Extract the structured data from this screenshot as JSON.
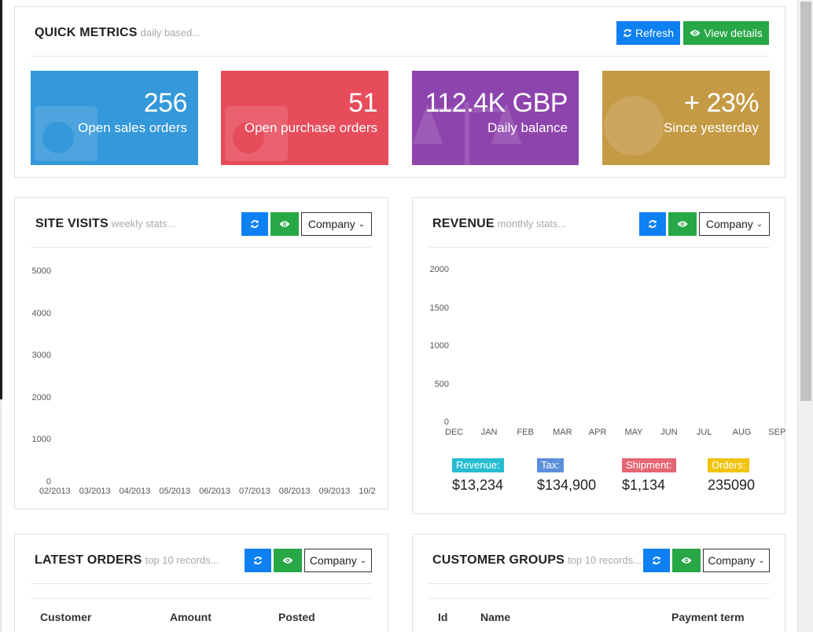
{
  "quick_metrics": {
    "title": "QUICK METRICS",
    "subtitle": "daily based...",
    "refresh_label": "Refresh",
    "view_details_label": "View details",
    "tiles": [
      {
        "value": "256",
        "caption": "Open sales orders",
        "color": "#3498db"
      },
      {
        "value": "51",
        "caption": "Open purchase orders",
        "color": "#e74c5b"
      },
      {
        "value": "112.4K GBP",
        "caption": "Daily balance",
        "color": "#8e44ad"
      },
      {
        "value": "+ 23%",
        "caption": "Since yesterday",
        "color": "#c59a45"
      }
    ]
  },
  "site_visits": {
    "title": "SITE VISITS",
    "subtitle": "weekly stats...",
    "dropdown_label": "Company"
  },
  "revenue": {
    "title": "REVENUE",
    "subtitle": "monthly stats...",
    "dropdown_label": "Company",
    "stats": [
      {
        "label": "Revenue:",
        "value": "$13,234",
        "color": "#26bcd0"
      },
      {
        "label": "Tax:",
        "value": "$134,900",
        "color": "#5b8fd9"
      },
      {
        "label": "Shipment:",
        "value": "$1,134",
        "color": "#e66574"
      },
      {
        "label": "Orders:",
        "value": "235090",
        "color": "#f1c40f"
      }
    ]
  },
  "latest_orders": {
    "title": "LATEST ORDERS",
    "subtitle": "top 10 records...",
    "dropdown_label": "Company",
    "columns": [
      "Customer",
      "Amount",
      "Posted"
    ]
  },
  "customer_groups": {
    "title": "CUSTOMER GROUPS",
    "subtitle": "top 10 records...",
    "dropdown_label": "Company",
    "columns": [
      "Id",
      "Name",
      "Payment term"
    ]
  },
  "colors": {
    "primary_button": "#0d80f2",
    "success_button": "#27a745"
  },
  "chart_data": [
    {
      "type": "line",
      "title": "SITE VISITS",
      "x": [
        "02/2013",
        "03/2013",
        "04/2013",
        "05/2013",
        "06/2013",
        "07/2013",
        "08/2013",
        "09/2013",
        "10/2"
      ],
      "ylim": [
        0,
        5000
      ],
      "yticks": [
        "5000",
        "4000",
        "3000",
        "2000",
        "1000",
        "0"
      ],
      "series": []
    },
    {
      "type": "line",
      "title": "REVENUE",
      "x": [
        "DEC",
        "JAN",
        "FEB",
        "MAR",
        "APR",
        "MAY",
        "JUN",
        "JUL",
        "AUG",
        "SEP"
      ],
      "ylim": [
        0,
        2000
      ],
      "yticks": [
        "2000",
        "1500",
        "1000",
        "500",
        "0"
      ],
      "series": []
    }
  ]
}
